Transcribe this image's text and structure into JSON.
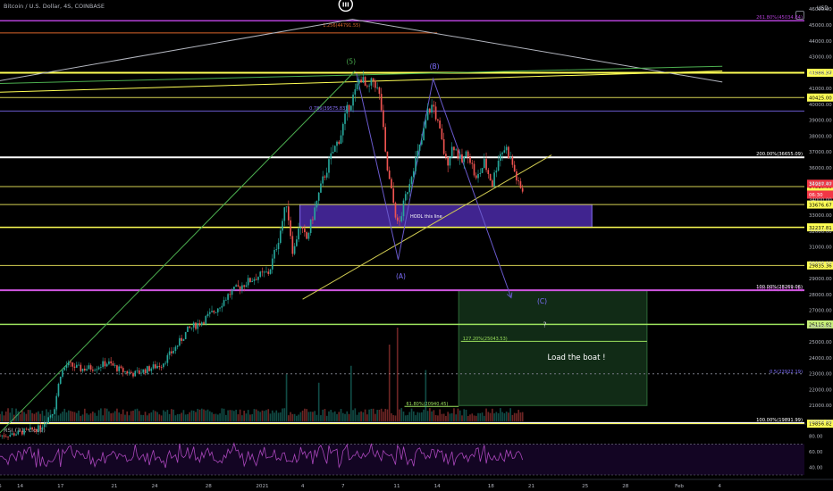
{
  "header": {
    "symbol_title": "Bitcoin / U.S. Dollar, 4S, COINBASE",
    "currency": "USD",
    "rsi_title": "RSI (21, close)"
  },
  "chart_data": [
    {
      "type": "candlestick",
      "title": "Bitcoin / U.S. Dollar, 4S, COINBASE",
      "ylim": [
        19000,
        46500
      ],
      "y_ticks": [
        20000,
        21000,
        22000,
        23000,
        24000,
        25000,
        26000,
        27000,
        28000,
        29000,
        30000,
        31000,
        32000,
        33000,
        34000,
        35000,
        36000,
        37000,
        38000,
        39000,
        40000,
        41000,
        42000,
        43000,
        44000,
        45000,
        46000
      ],
      "y_tick_labels": [
        "20000.00",
        "21000.00",
        "22000.00",
        "23000.00",
        "24000.00",
        "25000.00",
        "26000.00",
        "27000.00",
        "28000.00",
        "29000.00",
        "30000.00",
        "31000.00",
        "32000.00",
        "33000.00",
        "34000.00",
        "35000.00",
        "36000.00",
        "37000.00",
        "38000.00",
        "39000.00",
        "40000.00",
        "41000.00",
        "42000.00",
        "43000.00",
        "44000.00",
        "45000.00",
        "46000.00"
      ],
      "x_ticks": [
        {
          "label": "6:45",
          "day": 12.2
        },
        {
          "label": "14",
          "day": 14
        },
        {
          "label": "17",
          "day": 17
        },
        {
          "label": "21",
          "day": 21
        },
        {
          "label": "24",
          "day": 24
        },
        {
          "label": "28",
          "day": 28
        },
        {
          "label": "2021",
          "day": 32
        },
        {
          "label": "4",
          "day": 35
        },
        {
          "label": "7",
          "day": 38
        },
        {
          "label": "11",
          "day": 42
        },
        {
          "label": "14",
          "day": 45
        },
        {
          "label": "18",
          "day": 49
        },
        {
          "label": "21",
          "day": 52
        },
        {
          "label": "25",
          "day": 56
        },
        {
          "label": "28",
          "day": 59
        },
        {
          "label": "Feb",
          "day": 63
        },
        {
          "label": "4",
          "day": 66
        }
      ],
      "price_path": [
        [
          12.5,
          19100
        ],
        [
          13.5,
          19200
        ],
        [
          14.5,
          19400
        ],
        [
          15.5,
          19600
        ],
        [
          16.5,
          20700
        ],
        [
          17,
          23000
        ],
        [
          17.5,
          23600
        ],
        [
          18.5,
          23300
        ],
        [
          19.5,
          23400
        ],
        [
          20.5,
          23700
        ],
        [
          21.5,
          23200
        ],
        [
          22.5,
          23000
        ],
        [
          23.5,
          23300
        ],
        [
          24.5,
          23600
        ],
        [
          25.5,
          24600
        ],
        [
          26.5,
          25800
        ],
        [
          27.5,
          26300
        ],
        [
          28.5,
          27000
        ],
        [
          29.5,
          28000
        ],
        [
          30.5,
          28600
        ],
        [
          31.5,
          29100
        ],
        [
          32.5,
          29400
        ],
        [
          33.2,
          31500
        ],
        [
          33.8,
          33800
        ],
        [
          34.3,
          30500
        ],
        [
          34.7,
          32300
        ],
        [
          35.3,
          31500
        ],
        [
          35.9,
          33400
        ],
        [
          36.5,
          35200
        ],
        [
          37.2,
          36900
        ],
        [
          37.8,
          38000
        ],
        [
          38.4,
          39900
        ],
        [
          38.9,
          40700
        ],
        [
          39.3,
          41800
        ],
        [
          39.8,
          40800
        ],
        [
          40.3,
          41600
        ],
        [
          40.8,
          40200
        ],
        [
          41.2,
          36300
        ],
        [
          41.7,
          34000
        ],
        [
          42.1,
          32200
        ],
        [
          42.6,
          34000
        ],
        [
          43.2,
          36000
        ],
        [
          43.8,
          37500
        ],
        [
          44.3,
          39500
        ],
        [
          44.7,
          40000
        ],
        [
          45.2,
          38200
        ],
        [
          45.7,
          36200
        ],
        [
          46.2,
          37500
        ],
        [
          46.8,
          36300
        ],
        [
          47.3,
          37000
        ],
        [
          47.9,
          35200
        ],
        [
          48.5,
          36300
        ],
        [
          49.1,
          35000
        ],
        [
          49.6,
          36800
        ],
        [
          50.1,
          37300
        ],
        [
          50.6,
          36200
        ],
        [
          51.1,
          34700
        ],
        [
          51.5,
          34500
        ]
      ],
      "candle_count": 260,
      "volume_spikes": [
        {
          "day": 42.0,
          "rel": 1.0
        },
        {
          "day": 41.4,
          "rel": 0.8
        },
        {
          "day": 38.6,
          "rel": 0.55
        },
        {
          "day": 33.8,
          "rel": 0.45
        },
        {
          "day": 44.2,
          "rel": 0.5
        },
        {
          "day": 36.2,
          "rel": 0.35
        }
      ],
      "horizontal_levels": [
        {
          "price": 45270,
          "color": "#b23fd6",
          "width": 1.5,
          "label": "261.80%(45034.84)",
          "label_color": "#b23fd6",
          "right_box": false
        },
        {
          "price": 44500,
          "color": "#d9652b",
          "width": 1,
          "x_to_day": 45.0,
          "label": "",
          "right_box": false
        },
        {
          "price": 41986.37,
          "color": "#ffff55",
          "width": 2,
          "label": "41986.37",
          "right_box": true,
          "box_color": "#ffff55",
          "box_text": "#000"
        },
        {
          "price": 40425,
          "color": "#d4cf52",
          "width": 1,
          "label": "40425.00",
          "right_box": true,
          "box_color": "#ffff55",
          "box_text": "#000"
        },
        {
          "price": 39570,
          "color": "#6a5acd",
          "width": 1,
          "label": "",
          "right_box": false
        },
        {
          "price": 36655.09,
          "color": "#ffffff",
          "width": 2,
          "label": "200.00%(36655.09)",
          "label_color": "#ffffff",
          "right_box": false
        },
        {
          "price": 34810,
          "color": "#d4cf52",
          "width": 1,
          "label": "34810.00",
          "right_box": true,
          "box_color": "#ffff55",
          "box_text": "#000"
        },
        {
          "price": 33676.67,
          "color": "#d4cf52",
          "width": 1,
          "label": "33676.67",
          "right_box": true,
          "box_color": "#ffff55",
          "box_text": "#000"
        },
        {
          "price": 32237.81,
          "color": "#ffff55",
          "width": 1.5,
          "label": "32237.81",
          "right_box": true,
          "box_color": "#ffff55",
          "box_text": "#000"
        },
        {
          "price": 29835.36,
          "color": "#d4cf52",
          "width": 1,
          "label": "29835.36",
          "right_box": true,
          "box_color": "#ffff55",
          "box_text": "#000"
        },
        {
          "price": 28269.06,
          "color": "#d056e0",
          "width": 2,
          "label": "100.00%(28269.06)",
          "label_color": "#ffffff",
          "right_box": false
        },
        {
          "price": 28150,
          "color": "#d056e0",
          "width": 0,
          "label": "100.00%(28273.76)",
          "label_color": "#d056e0",
          "right_box": false,
          "label_only": true
        },
        {
          "price": 26115.82,
          "color": "#9be15d",
          "width": 1.5,
          "label": "26115.82",
          "right_box": true,
          "box_color": "#c8f07a",
          "box_text": "#000"
        },
        {
          "price": 22922.19,
          "color": "#6a5acd",
          "width": 0,
          "label": "0.5(22922.19)",
          "label_color": "#7f6fff",
          "right_box": false,
          "label_only": true
        },
        {
          "price": 23000,
          "color": "#787b86",
          "width": 1,
          "dashed": true,
          "label": "",
          "right_box": false
        },
        {
          "price": 19891.99,
          "color": "#ffffff",
          "width": 2,
          "label": "100.00%(19891.99)",
          "label_color": "#ffffff",
          "right_box": false
        },
        {
          "price": 19856.82,
          "color": "#ffff55",
          "width": 1,
          "label": "19856.82",
          "right_box": true,
          "box_color": "#ffff55",
          "box_text": "#000"
        }
      ],
      "price_tags": [
        {
          "price": 34987.47,
          "label": "34987.47",
          "color": "#f23645"
        },
        {
          "price": 34300,
          "label": "06:30",
          "color": "#f23645"
        }
      ],
      "zones": [
        {
          "name": "hodl-box",
          "day_from": 34.8,
          "day_to": 56.5,
          "price_from": 32237.81,
          "price_to": 33676.67,
          "fill": "#4b2aa8",
          "stroke": "#8a73ff",
          "text": "HODL this line",
          "text_day": 43.0,
          "text_price": 32950
        },
        {
          "name": "target-box",
          "day_from": 46.6,
          "day_to": 60.6,
          "price_from": 21000,
          "price_to": 28269.06,
          "fill": "#14331a",
          "stroke": "#2e6b38",
          "text": "Load the boat !",
          "text_day": 53.2,
          "text_price": 24000
        }
      ],
      "fib_labels": [
        {
          "text": "127.20%(25043.53)",
          "day": 46.9,
          "price": 25043.53,
          "color": "#9be15d",
          "line_to_day": 60.6
        },
        {
          "text": "61.80%(20940.45)",
          "day": 42.7,
          "price": 20940.45,
          "color": "#9be15d",
          "line_to_day": 46.6
        },
        {
          "text": "1.256(44791.55)",
          "day": 36.5,
          "price": 44791.55,
          "color": "#d9652b"
        },
        {
          "text": "0.786(39575.83)",
          "day": 35.5,
          "price": 39575.83,
          "color": "#8a73ff"
        }
      ],
      "wave_labels": [
        {
          "text": "III",
          "day": 38.2,
          "price": 46300,
          "circled": true,
          "color": "#ffffff"
        },
        {
          "text": "(5)",
          "day": 38.6,
          "price": 42550,
          "color": "#4caf50"
        },
        {
          "text": "(B)",
          "day": 44.8,
          "price": 42250,
          "color": "#7f6fff"
        },
        {
          "text": "(A)",
          "day": 42.3,
          "price": 29000,
          "color": "#7f6fff"
        },
        {
          "text": "(C)",
          "day": 52.8,
          "price": 27420,
          "color": "#7f6fff"
        },
        {
          "text": "?",
          "day": 53.0,
          "price": 25950,
          "color": "#d1d4dc"
        }
      ],
      "trend_lines": [
        {
          "points": [
            [
              11.9,
              41400
            ],
            [
              38.7,
              45360
            ],
            [
              66.2,
              41400
            ]
          ],
          "color": "#b2b5be"
        },
        {
          "points": [
            [
              11.9,
              41300
            ],
            [
              66.2,
              42400
            ]
          ],
          "color": "#4caf50"
        },
        {
          "points": [
            [
              11.9,
              40750
            ],
            [
              66.2,
              42100
            ]
          ],
          "color": "#ffff55"
        },
        {
          "points": [
            [
              12.4,
              19200
            ],
            [
              38.9,
              42100
            ]
          ],
          "color": "#4caf50"
        },
        {
          "points": [
            [
              35.0,
              27700
            ],
            [
              53.5,
              36800
            ]
          ],
          "color": "#d4cf52"
        },
        {
          "points": [
            [
              39.0,
              41950
            ],
            [
              42.1,
              30200
            ],
            [
              44.7,
              41600
            ],
            [
              50.5,
              27800
            ]
          ],
          "color": "#6a5acd",
          "arrow_end": true
        }
      ],
      "rsi": {
        "title": "RSI (21, close)",
        "ylim": [
          30,
          90
        ],
        "y_ticks": [
          40,
          60,
          80
        ],
        "y_tick_labels": [
          "40.00",
          "60.00",
          "80.00"
        ],
        "band_upper": 70,
        "band_lower": 30
      }
    }
  ]
}
